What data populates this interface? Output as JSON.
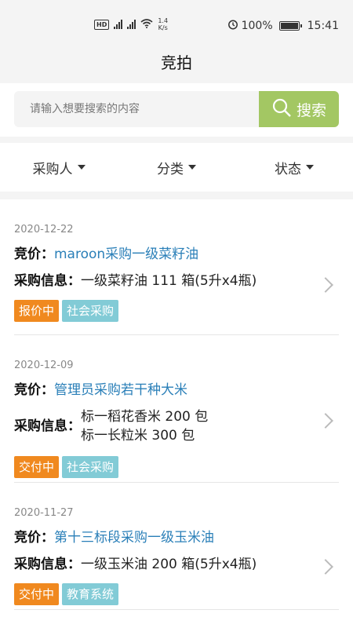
{
  "status_bar": {
    "network_speed_value": "1.4",
    "network_speed_unit": "K/s",
    "battery_percent": "100%",
    "time": "15:41"
  },
  "header": {
    "title": "竞拍"
  },
  "search": {
    "placeholder": "请输入想要搜索的内容",
    "button_label": "搜索"
  },
  "filters": [
    {
      "label": "采购人"
    },
    {
      "label": "分类"
    },
    {
      "label": "状态"
    }
  ],
  "labels": {
    "bid": "竞价：",
    "purchase_info": "采购信息："
  },
  "items": [
    {
      "date": "2020-12-22",
      "bid_title": "maroon采购一级菜籽油",
      "info_lines": [
        "一级菜籽油 111 箱(5升x4瓶)"
      ],
      "status_tag": "报价中",
      "category_tag": "社会采购"
    },
    {
      "date": "2020-12-09",
      "bid_title": "管理员采购若干种大米",
      "info_lines": [
        "标一稻花香米 200 包",
        "标一长粒米 300 包"
      ],
      "status_tag": "交付中",
      "category_tag": "社会采购"
    },
    {
      "date": "2020-11-27",
      "bid_title": "第十三标段采购一级玉米油",
      "info_lines": [
        "一级玉米油 200 箱(5升x4瓶)"
      ],
      "status_tag": "交付中",
      "category_tag": "教育系统"
    }
  ],
  "colors": {
    "accent_green": "#a3c763",
    "link_blue": "#2a7fb8",
    "status_orange": "#f0891f",
    "category_teal": "#82cbd6"
  }
}
